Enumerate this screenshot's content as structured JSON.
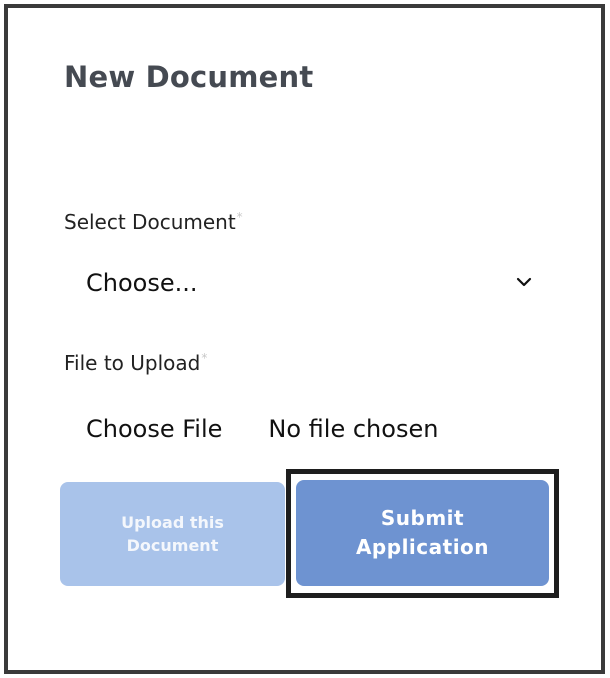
{
  "form": {
    "title": "New Document",
    "select_label": "Select Document",
    "select_required_mark": "*",
    "select_value": "Choose...",
    "file_label": "File to Upload",
    "file_required_mark": "*",
    "file_button": "Choose File",
    "file_status": "No file chosen"
  },
  "buttons": {
    "upload": {
      "line1": "Upload this",
      "line2": "Document"
    },
    "submit": {
      "line1": "Submit",
      "line2": "Application"
    }
  },
  "colors": {
    "upload_disabled_bg": "#a9c3ea",
    "submit_bg": "#6e93d1",
    "title_color": "#454a52"
  },
  "icons": {
    "select_dropdown": "chevron-down-icon"
  }
}
